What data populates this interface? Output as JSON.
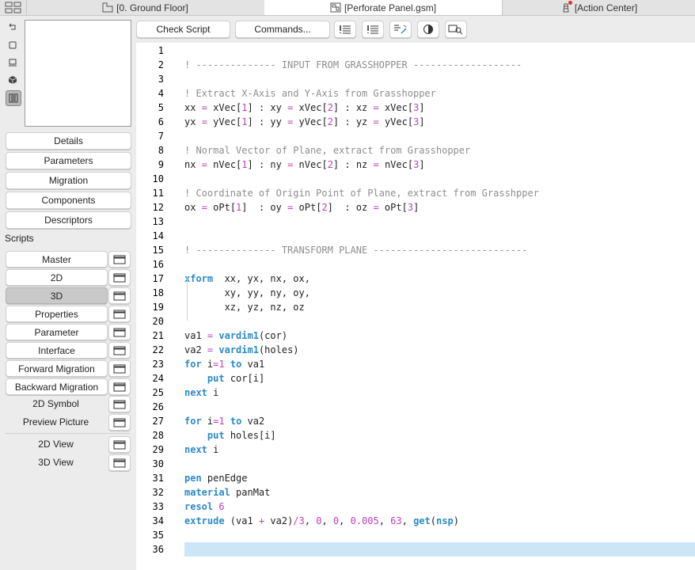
{
  "tabs": [
    {
      "label": "[0. Ground Floor]",
      "icon": "floor-plan-icon"
    },
    {
      "label": "[Perforate Panel.gsm]",
      "icon": "gsm-object-icon"
    },
    {
      "label": "[Action Center]",
      "icon": "lighthouse-icon"
    }
  ],
  "sidebar": {
    "view_icons": [
      "rotate-view-icon",
      "square-view-icon",
      "stand-view-icon",
      "3d-box-icon",
      "filmstrip-icon"
    ],
    "nav_buttons": [
      "Details",
      "Parameters",
      "Migration",
      "Components",
      "Descriptors"
    ],
    "scripts_label": "Scripts",
    "scripts": [
      {
        "label": "Master",
        "selected": false
      },
      {
        "label": "2D",
        "selected": false
      },
      {
        "label": "3D",
        "selected": true
      },
      {
        "label": "Properties",
        "selected": false
      },
      {
        "label": "Parameter",
        "selected": false
      },
      {
        "label": "Interface",
        "selected": false
      },
      {
        "label": "Forward Migration",
        "selected": false
      },
      {
        "label": "Backward Migration",
        "selected": false
      }
    ],
    "plain_items": [
      "2D Symbol",
      "Preview Picture"
    ],
    "view_items": [
      "2D View",
      "3D View"
    ]
  },
  "toolbar": {
    "check_script": "Check Script",
    "commands": "Commands...",
    "icons": [
      "comment-list-icon",
      "list-icon",
      "format-wand-icon",
      "contrast-icon",
      "find-replace-icon"
    ]
  },
  "editor": {
    "current_line": 36,
    "lines": [
      {
        "n": "1",
        "code": ""
      },
      {
        "n": "2",
        "code": "! -------------- INPUT FROM GRASSHOPPER -------------------"
      },
      {
        "n": "3",
        "code": ""
      },
      {
        "n": "4",
        "code": "! Extract X-Axis and Y-Axis from Grasshopper"
      },
      {
        "n": "5",
        "code": "xx = xVec[1] : xy = xVec[2] : xz = xVec[3]"
      },
      {
        "n": "6",
        "code": "yx = yVec[1] : yy = yVec[2] : yz = yVec[3]"
      },
      {
        "n": "7",
        "code": ""
      },
      {
        "n": "8",
        "code": "! Normal Vector of Plane, extract from Grasshopper"
      },
      {
        "n": "9",
        "code": "nx = nVec[1] : ny = nVec[2] : nz = nVec[3]"
      },
      {
        "n": "10",
        "code": ""
      },
      {
        "n": "11",
        "code": "! Coordinate of Origin Point of Plane, extract from Grasshpper"
      },
      {
        "n": "12",
        "code": "ox = oPt[1]  : oy = oPt[2]  : oz = oPt[3]"
      },
      {
        "n": "13",
        "code": ""
      },
      {
        "n": "14",
        "code": ""
      },
      {
        "n": "15",
        "code": "! -------------- TRANSFORM PLANE ---------------------------"
      },
      {
        "n": "16",
        "code": ""
      },
      {
        "n": "17",
        "code": "xform  xx, yx, nx, ox,"
      },
      {
        "n": "18",
        "code": "       xy, yy, ny, oy,"
      },
      {
        "n": "19",
        "code": "       xz, yz, nz, oz"
      },
      {
        "n": "20",
        "code": ""
      },
      {
        "n": "21",
        "code": "va1 = vardim1(cor)"
      },
      {
        "n": "22",
        "code": "va2 = vardim1(holes)"
      },
      {
        "n": "23",
        "code": "for i=1 to va1"
      },
      {
        "n": "24",
        "code": "    put cor[i]"
      },
      {
        "n": "25",
        "code": "next i"
      },
      {
        "n": "26",
        "code": ""
      },
      {
        "n": "27",
        "code": "for i=1 to va2"
      },
      {
        "n": "28",
        "code": "    put holes[i]"
      },
      {
        "n": "29",
        "code": "next i"
      },
      {
        "n": "30",
        "code": ""
      },
      {
        "n": "31",
        "code": "pen penEdge"
      },
      {
        "n": "32",
        "code": "material panMat"
      },
      {
        "n": "33",
        "code": "resol 6"
      },
      {
        "n": "34",
        "code": "extrude (va1 + va2)/3, 0, 0, 0.005, 63, get(nsp)"
      },
      {
        "n": "35",
        "code": ""
      },
      {
        "n": "36",
        "code": ""
      }
    ]
  },
  "colors": {
    "keyword": "#2c8ac7",
    "number": "#c03ec0",
    "comment": "#8e8e8e",
    "current_line": "#cde6f7",
    "notification_dot": "#e0342b"
  }
}
